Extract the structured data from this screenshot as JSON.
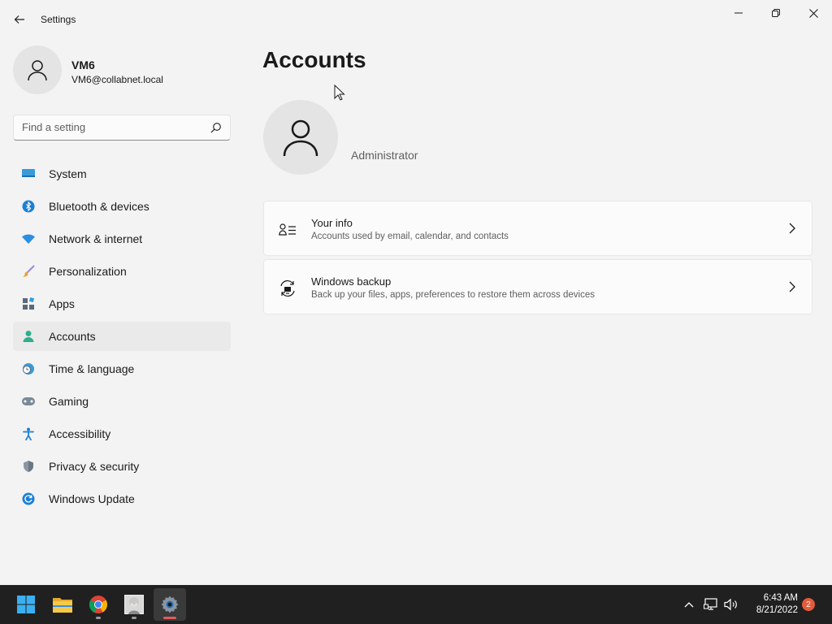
{
  "window": {
    "title": "Settings"
  },
  "profile": {
    "name": "VM6",
    "email": "VM6@collabnet.local"
  },
  "search": {
    "placeholder": "Find a setting"
  },
  "nav": {
    "items": [
      {
        "label": "System",
        "icon": "system-icon"
      },
      {
        "label": "Bluetooth & devices",
        "icon": "bluetooth-icon"
      },
      {
        "label": "Network & internet",
        "icon": "wifi-icon"
      },
      {
        "label": "Personalization",
        "icon": "brush-icon"
      },
      {
        "label": "Apps",
        "icon": "apps-icon"
      },
      {
        "label": "Accounts",
        "icon": "accounts-icon",
        "active": true
      },
      {
        "label": "Time & language",
        "icon": "clock-globe-icon"
      },
      {
        "label": "Gaming",
        "icon": "gamepad-icon"
      },
      {
        "label": "Accessibility",
        "icon": "accessibility-icon"
      },
      {
        "label": "Privacy & security",
        "icon": "shield-icon"
      },
      {
        "label": "Windows Update",
        "icon": "update-icon"
      }
    ]
  },
  "main": {
    "title": "Accounts",
    "role": "Administrator",
    "cards": [
      {
        "title": "Your info",
        "subtitle": "Accounts used by email, calendar, and contacts",
        "icon": "person-list-icon"
      },
      {
        "title": "Windows backup",
        "subtitle": "Back up your files, apps, preferences to restore them across devices",
        "icon": "backup-icon"
      }
    ]
  },
  "taskbar": {
    "apps": [
      "start-icon",
      "file-explorer-icon",
      "chrome-icon",
      "app-thumbnail-icon",
      "settings-icon"
    ],
    "clock": {
      "time": "6:43 AM",
      "date": "8/21/2022"
    },
    "notification_count": "2"
  },
  "colors": {
    "accent": "#0067c0",
    "background": "#f3f3f3",
    "taskbar": "#202020",
    "badge": "#e25b3a"
  }
}
